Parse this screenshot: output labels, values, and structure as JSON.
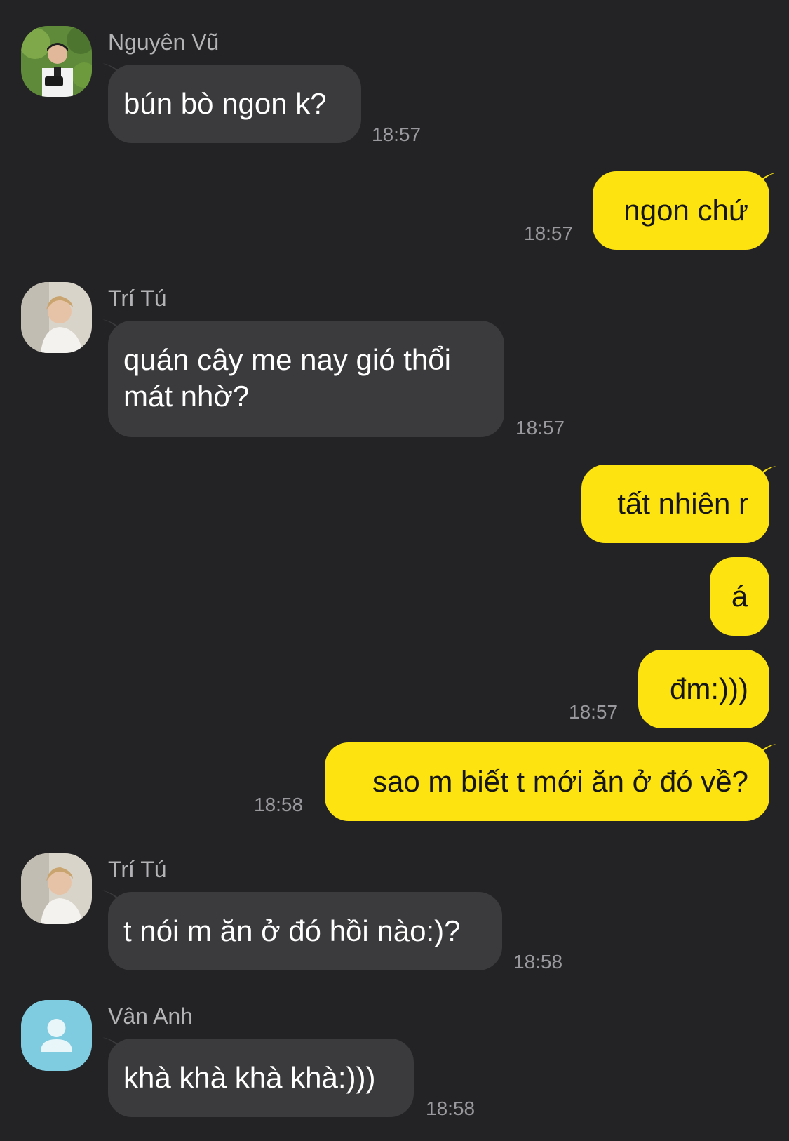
{
  "conversation": {
    "messages": [
      {
        "sender": "Nguyên Vũ",
        "avatar": "photo-avatar",
        "text": "bún bò ngon k?",
        "time": "18:57"
      },
      {
        "sender": "me",
        "text": "ngon chứ",
        "time": "18:57"
      },
      {
        "sender": "Trí Tú",
        "avatar": "photo-avatar",
        "text_line1": "quán cây me nay gió thổi",
        "text_line2": "mát nhờ?",
        "time": "18:57"
      },
      {
        "sender": "me",
        "text": "tất nhiên r"
      },
      {
        "sender": "me",
        "text": "á"
      },
      {
        "sender": "me",
        "text": "đm:)))",
        "time": "18:57"
      },
      {
        "sender": "me",
        "text": "sao m biết t mới ăn ở đó về?",
        "time": "18:58"
      },
      {
        "sender": "Trí Tú",
        "avatar": "photo-avatar",
        "text": "t nói m ăn ở đó hồi nào:)?",
        "time": "18:58"
      },
      {
        "sender": "Vân Anh",
        "avatar": "default-person-icon",
        "text": "khà khà khà khà:)))",
        "time": "18:58"
      }
    ]
  },
  "colors": {
    "background": "#232325",
    "incoming_bubble": "#3b3b3e",
    "outgoing_bubble": "#fde410",
    "sender_name": "#b3b3b6",
    "timestamp": "#9a9a9e",
    "default_avatar": "#7fcbe0"
  }
}
